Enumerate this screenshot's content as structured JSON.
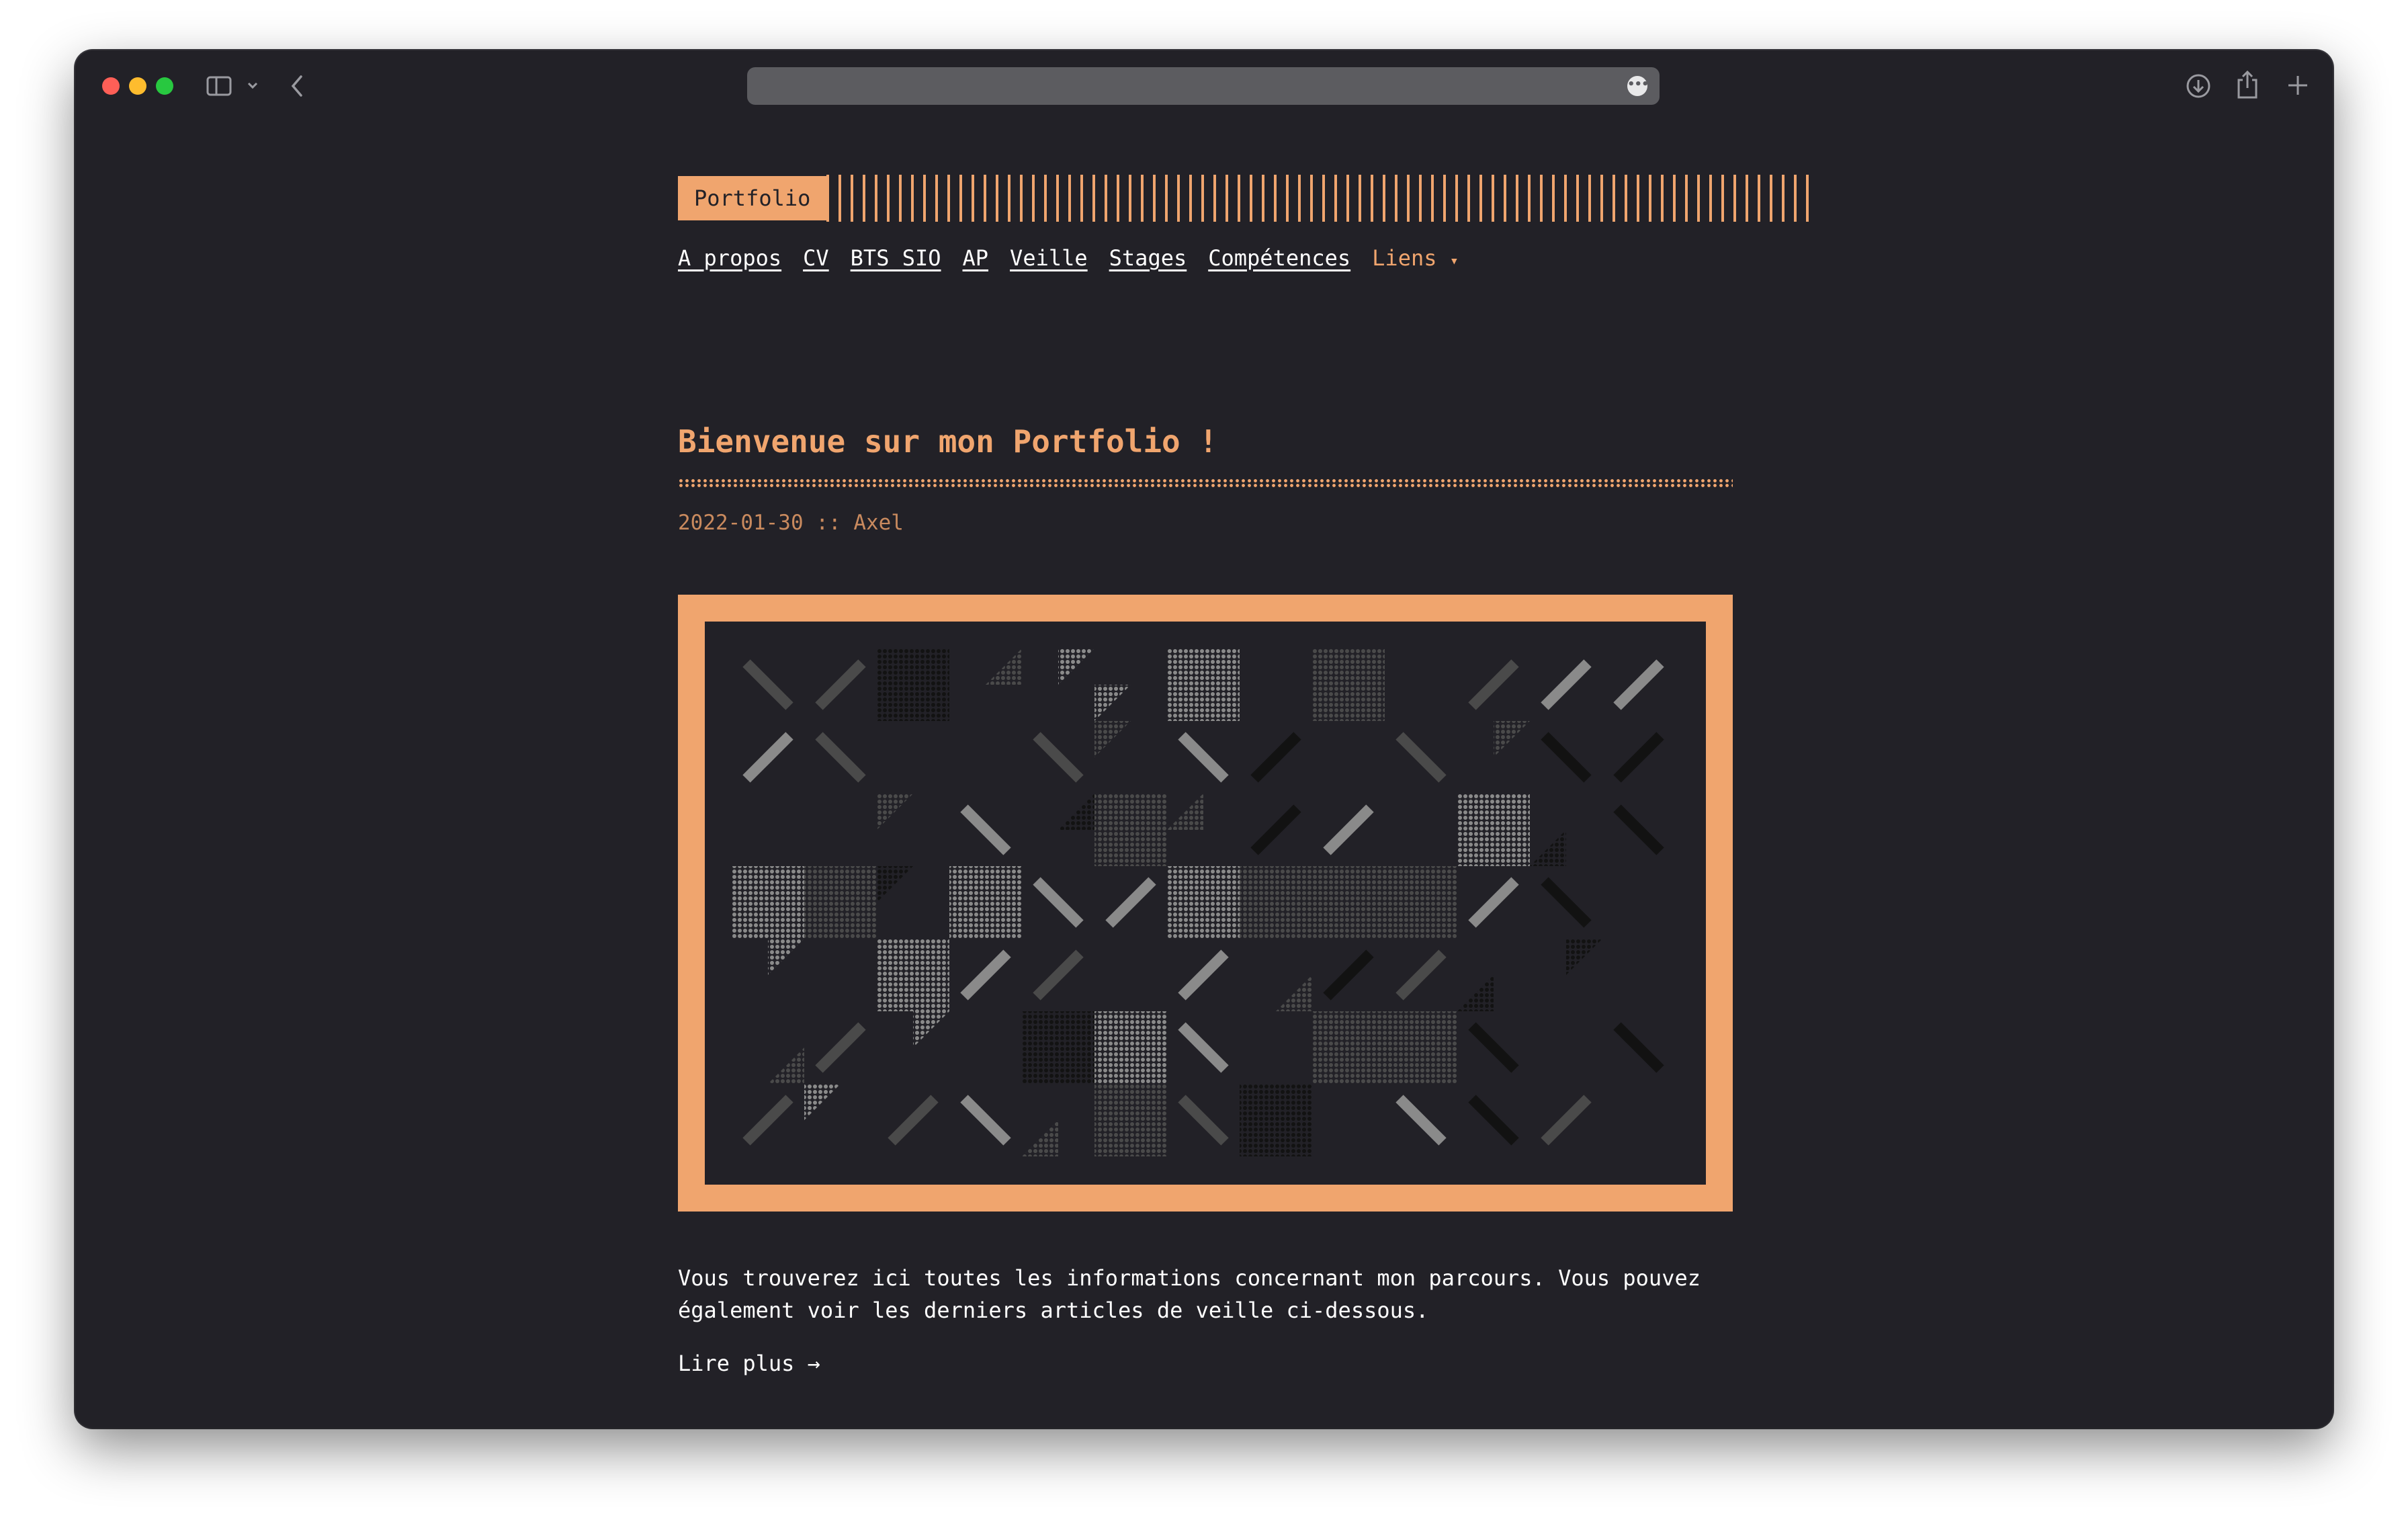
{
  "browser": {
    "icons": [
      "close-dot",
      "minimize-dot",
      "zoom-dot",
      "sidebar-icon",
      "chevron-down-icon",
      "back-icon",
      "more-icon",
      "download-icon",
      "share-icon",
      "plus-icon"
    ]
  },
  "site": {
    "logo": "Portfolio"
  },
  "nav": {
    "items": [
      "A propos",
      "CV",
      "BTS SIO",
      "AP",
      "Veille",
      "Stages",
      "Compétences"
    ],
    "dropdown_label": "Liens",
    "dropdown_arrow": "▾"
  },
  "post": {
    "title": "Bienvenue sur mon Portfolio !",
    "date": "2022-01-30",
    "separator": "::",
    "author": "Axel",
    "body": "Vous trouverez ici toutes les informations concernant mon parcours. Vous pouvez également voir les derniers articles de veille ci-dessous.",
    "read_more": "Lire plus →"
  },
  "colors": {
    "accent": "#f0a56e",
    "background": "#222127",
    "text": "#ffffff"
  }
}
